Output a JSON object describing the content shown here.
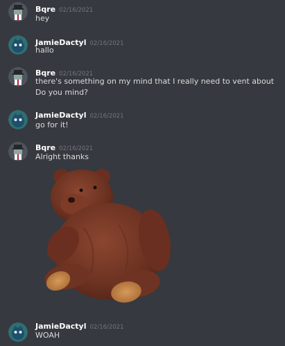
{
  "messages": [
    {
      "username": "Bqre",
      "timestamp": "02/16/2021",
      "lines": [
        "hey"
      ]
    },
    {
      "username": "JamieDactyl",
      "timestamp": "02/16/2021",
      "lines": [
        "hallo"
      ]
    },
    {
      "username": "Bqre",
      "timestamp": "02/16/2021",
      "lines": [
        "there's something on my mind that I really need to vent about",
        "Do you mind?"
      ]
    },
    {
      "username": "JamieDactyl",
      "timestamp": "02/16/2021",
      "lines": [
        "go for it!"
      ]
    },
    {
      "username": "Bqre",
      "timestamp": "02/16/2021",
      "lines": [
        "Alright thanks"
      ],
      "attachment": "teddy-bear-image"
    },
    {
      "username": "JamieDactyl",
      "timestamp": "02/16/2021",
      "lines": [
        "WOAH"
      ]
    }
  ],
  "colors": {
    "background": "#36393f",
    "username": "#ffffff",
    "timestamp": "#72767d",
    "text": "#dcddde",
    "bqre_avatar_bg": "#4f545c",
    "jamie_avatar_bg": "#2f6f73"
  }
}
